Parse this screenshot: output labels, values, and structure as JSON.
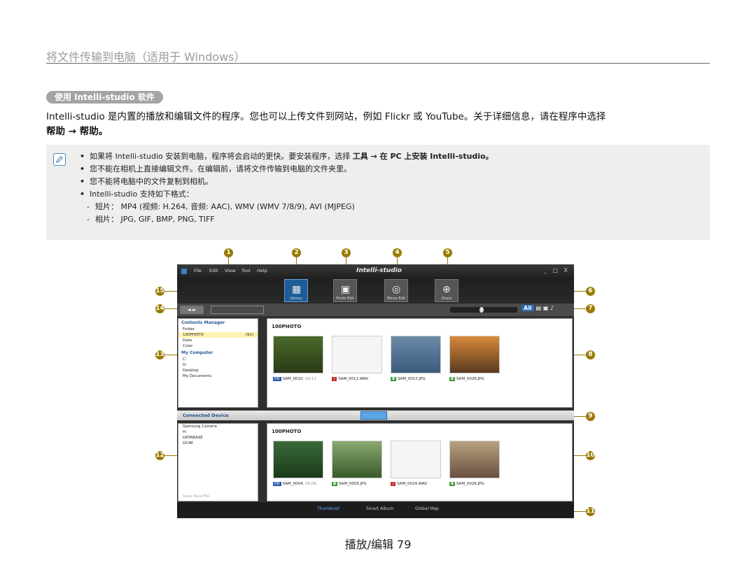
{
  "header": {
    "title": "将文件传输到电脑（适用于 Windows）"
  },
  "section": {
    "label": "使用 Intelli-studio 软件"
  },
  "intro": {
    "line1": "Intelli-studio 是内置的播放和编辑文件的程序。您也可以上传文件到网站，例如 Flickr 或 YouTube。关于详细信息，请在程序中选择",
    "line2": "帮助 → 帮助。"
  },
  "notes": {
    "n1_pre": "如果将 Intelli-studio 安装到电脑，程序将会启动的更快。要安装程序，选择",
    "n1_bold": "工具 → 在 PC 上安装 Intelli-studio。",
    "n2": "您不能在相机上直接编辑文件。在编辑前，请将文件传输到电脑的文件夹里。",
    "n3": "您不能将电脑中的文件复制到相机。",
    "n4": "Intelli-studio 支持如下格式：",
    "d1": "短片： MP4 (视频: H.264, 音频: AAC), WMV (WMV 7/8/9), AVI (MJPEG)",
    "d2": "相片： JPG, GIF, BMP, PNG, TIFF"
  },
  "callouts": [
    "1",
    "2",
    "3",
    "4",
    "5",
    "6",
    "7",
    "8",
    "9",
    "10",
    "11",
    "12",
    "13",
    "14",
    "15"
  ],
  "app": {
    "name": "Intelli-studio",
    "menu": [
      "File",
      "Edit",
      "View",
      "Tool",
      "Help"
    ],
    "window_controls": "_ □ X",
    "tools": [
      {
        "label": "Library",
        "icon": "library-icon"
      },
      {
        "label": "Photo Edit",
        "icon": "photo-edit-icon"
      },
      {
        "label": "Movie Edit",
        "icon": "movie-edit-icon"
      },
      {
        "label": "Share",
        "icon": "share-icon"
      }
    ],
    "nav_arrows": "◄ ►",
    "filter_all": "All",
    "left_tree": {
      "header": "Contents Manager",
      "rows": [
        "Folder",
        "100PHOTO",
        "Date",
        "Color"
      ],
      "count": "(91)",
      "my_computer": "My Computer",
      "drives": [
        "C:",
        "D:",
        "Desktop",
        "My Documents"
      ]
    },
    "pc_folder": "100PHOTO",
    "pc_thumbs": [
      {
        "tag": "HD",
        "name": "SAM_0010.",
        "dur": "00:11"
      },
      {
        "tag": "♪",
        "name": "SAM_0011.WAV",
        "dur": ""
      },
      {
        "tag": "◘",
        "name": "SAM_0012.JPG",
        "dur": ""
      },
      {
        "tag": "◘",
        "name": "SAM_0026.JPG",
        "dur": ""
      }
    ],
    "device_bar": "Connected Device",
    "device_tree": [
      "Samsung Camera",
      "H:",
      "DATABASE",
      "DCIM"
    ],
    "save_new": "Save New File",
    "dev_folder": "100PHOTO",
    "dev_thumbs": [
      {
        "tag": "HD",
        "name": "SAM_0004.",
        "dur": "00:06"
      },
      {
        "tag": "◘",
        "name": "SAM_0005.JPG",
        "dur": ""
      },
      {
        "tag": "♪",
        "name": "SAM_0024.WAV",
        "dur": ""
      },
      {
        "tag": "◘",
        "name": "SAM_0026.JPG",
        "dur": ""
      }
    ],
    "bottom_tabs": [
      "Thumbnail",
      "Smart Album",
      "Global Map"
    ]
  },
  "footer": {
    "text": "播放/编辑 79"
  }
}
